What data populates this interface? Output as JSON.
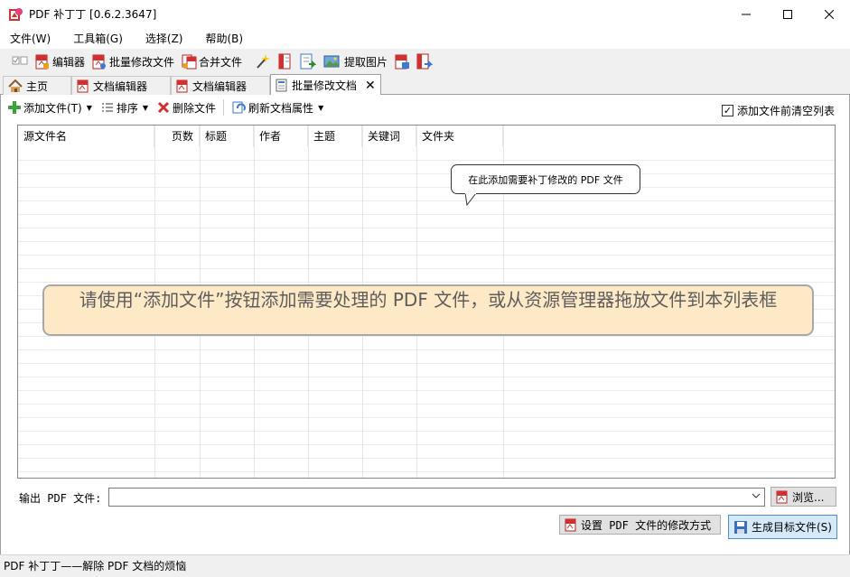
{
  "window": {
    "title": "PDF 补丁丁 [0.6.2.3647]"
  },
  "menu": [
    "文件(W)",
    "工具箱(G)",
    "选择(Z)",
    "帮助(B)"
  ],
  "toolbar": {
    "editor": "编辑器",
    "batch_modify": "批量修改文件",
    "merge": "合并文件",
    "extract_images": "提取图片"
  },
  "tabs": [
    {
      "label": "主页"
    },
    {
      "label": "文档编辑器"
    },
    {
      "label": "文档编辑器"
    },
    {
      "label": "批量修改文档"
    }
  ],
  "subtoolbar": {
    "add_file": "添加文件(T)",
    "sort": "排序",
    "delete": "删除文件",
    "refresh": "刷新文档属性"
  },
  "clear_before_add": {
    "label": "添加文件前清空列表",
    "checked": true,
    "mark": "✓"
  },
  "columns": [
    "源文件名",
    "页数",
    "标题",
    "作者",
    "主题",
    "关键词",
    "文件夹"
  ],
  "tooltip": "在此添加需要补丁修改的 PDF 文件",
  "hint": "请使用“添加文件”按钮添加需要处理的 PDF 文件，或从资源管理器拖放文件到本列表框",
  "output": {
    "label": "输出 PDF 文件:",
    "value": ""
  },
  "buttons": {
    "browse": "浏览...",
    "modify_settings": "设置 PDF 文件的修改方式",
    "generate": "生成目标文件(S)"
  },
  "status": "PDF 补丁丁——解除 PDF 文档的烦恼",
  "colors": {
    "accent": "#4a8fd8",
    "hint_bg": "#fde9c6",
    "pdf_red": "#d0302f"
  }
}
